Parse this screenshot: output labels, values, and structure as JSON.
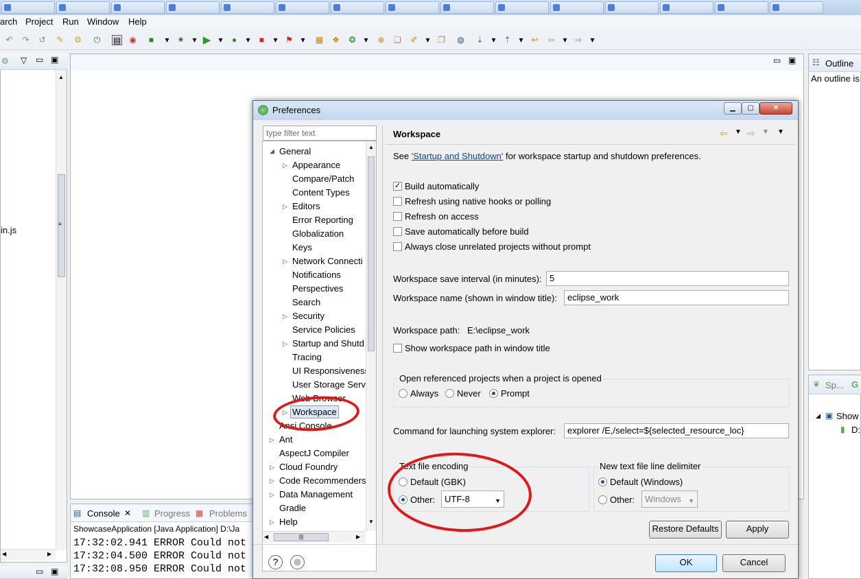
{
  "browser_tabs": [
    "",
    "",
    "",
    "",
    "",
    "",
    "",
    "",
    "",
    "",
    "",
    "",
    "",
    "",
    "",
    "",
    ""
  ],
  "menu": [
    "arch",
    "Project",
    "Run",
    "Window",
    "Help"
  ],
  "outline": {
    "title": "Outline",
    "message": "An outline is"
  },
  "left_panel": {
    "file": "in.js"
  },
  "right_lower": {
    "tab": "Sp...",
    "tab2": "G",
    "item": "Show",
    "subitem": "D:"
  },
  "console": {
    "tabs": [
      "Console",
      "Progress",
      "Problems"
    ],
    "header": "ShowcaseApplication [Java Application] D:\\Ja",
    "lines": [
      "17:32:02.941 ERROR Could not",
      "17:32:04.500 ERROR Could not",
      "17:32:08.950 ERROR Could not"
    ]
  },
  "dialog": {
    "title": "Preferences",
    "filter_placeholder": "type filter text",
    "page_title": "Workspace",
    "tree": {
      "general": "General",
      "children": [
        "Appearance",
        "Compare/Patch",
        "Content Types",
        "Editors",
        "Error Reporting",
        "Globalization",
        "Keys",
        "Network Connecti",
        "Notifications",
        "Perspectives",
        "Search",
        "Security",
        "Service Policies",
        "Startup and Shutd",
        "Tracing",
        "UI Responsiveness",
        "User Storage Serv",
        "Web Browser",
        "Workspace"
      ],
      "top_level": [
        "Ansi Console",
        "Ant",
        "AspectJ Compiler",
        "Cloud Foundry",
        "Code Recommenders",
        "Data Management",
        "Gradle",
        "Help"
      ]
    },
    "see_prefix": "See ",
    "see_link": "'Startup and Shutdown'",
    "see_suffix": " for workspace startup and shutdown preferences.",
    "checks": [
      {
        "label": "Build automatically",
        "checked": true
      },
      {
        "label": "Refresh using native hooks or polling",
        "checked": false
      },
      {
        "label": "Refresh on access",
        "checked": false
      },
      {
        "label": "Save automatically before build",
        "checked": false
      },
      {
        "label": "Always close unrelated projects without prompt",
        "checked": false
      }
    ],
    "save_interval_label": "Workspace save interval (in minutes):",
    "save_interval": "5",
    "name_label": "Workspace name (shown in window title):",
    "name_value": "eclipse_work",
    "path_label": "Workspace path:",
    "path_value": "E:\\eclipse_work",
    "show_path_label": "Show workspace path in window title",
    "open_ref": {
      "label": "Open referenced projects when a project is opened",
      "options": [
        "Always",
        "Never",
        "Prompt"
      ],
      "selected": "Prompt"
    },
    "cmd_label": "Command for launching system explorer:",
    "cmd_value": "explorer /E,/select=${selected_resource_loc}",
    "encoding": {
      "label": "Text file encoding",
      "default": "Default (GBK)",
      "other": "Other:",
      "value": "UTF-8"
    },
    "delimiter": {
      "label": "New text file line delimiter",
      "default": "Default (Windows)",
      "other": "Other:",
      "value": "Windows"
    },
    "restore": "Restore Defaults",
    "apply": "Apply",
    "ok": "OK",
    "cancel": "Cancel",
    "help_icon": "?"
  }
}
